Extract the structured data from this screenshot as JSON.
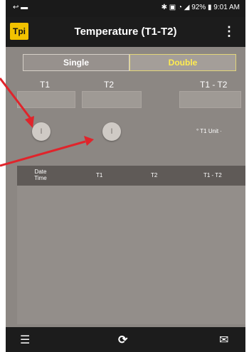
{
  "statusbar": {
    "left_icons": "↩ ▬",
    "right_text": "✱ ▣ ◔ ◢ 92% ▮ 9:01 AM"
  },
  "appbar": {
    "logo_text": "Tpi",
    "title": "Temperature (T1-T2)",
    "menu": "⋮"
  },
  "mode": {
    "single": "Single",
    "double": "Double",
    "selected": "Double"
  },
  "columns": {
    "t1": "T1",
    "t2": "T2",
    "diff": "T1 - T2"
  },
  "buttons": {
    "t1_btn": "I",
    "t2_btn": "I"
  },
  "unit_label": "° T1 Unit ·",
  "table": {
    "headers": [
      "Date Time",
      "T1",
      "T2",
      "T1 - T2"
    ]
  },
  "bottombar": {
    "list_icon": "☰",
    "refresh_icon": "⟳",
    "mail_icon": "✉"
  },
  "colors": {
    "accent": "#f2c200",
    "annotation": "#e0242b"
  }
}
